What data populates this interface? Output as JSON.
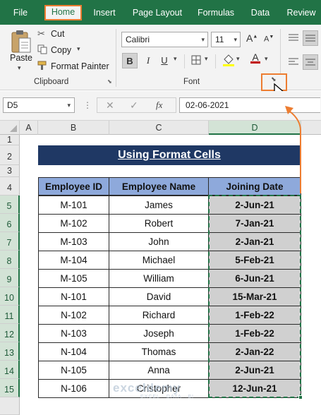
{
  "ribbon_tabs": [
    "File",
    "Home",
    "Insert",
    "Page Layout",
    "Formulas",
    "Data",
    "Review"
  ],
  "active_tab": "Home",
  "clipboard": {
    "paste": "Paste",
    "cut": "Cut",
    "copy": "Copy",
    "format_painter": "Format Painter",
    "group_label": "Clipboard"
  },
  "font": {
    "font_name": "Calibri",
    "font_size": "11",
    "bold": "B",
    "italic": "I",
    "underline": "U",
    "group_label": "Font",
    "grow_font": "A",
    "shrink_font": "A"
  },
  "formula_bar": {
    "name_box": "D5",
    "fx": "fx",
    "value": "02-06-2021"
  },
  "columns": [
    "A",
    "B",
    "C",
    "D"
  ],
  "rows": [
    "1",
    "2",
    "3",
    "4",
    "5",
    "6",
    "7",
    "8",
    "9",
    "10",
    "11",
    "12",
    "13",
    "14",
    "15"
  ],
  "sheet": {
    "title": "Using Format Cells",
    "headers": [
      "Employee ID",
      "Employee Name",
      "Joining Date"
    ],
    "rows": [
      {
        "id": "M-101",
        "name": "James",
        "date": "2-Jun-21"
      },
      {
        "id": "M-102",
        "name": "Robert",
        "date": "7-Jan-21"
      },
      {
        "id": "M-103",
        "name": "John",
        "date": "2-Jan-21"
      },
      {
        "id": "M-104",
        "name": "Michael",
        "date": "5-Feb-21"
      },
      {
        "id": "M-105",
        "name": "William",
        "date": "6-Jun-21"
      },
      {
        "id": "N-101",
        "name": "David",
        "date": "15-Mar-21"
      },
      {
        "id": "N-102",
        "name": "Richard",
        "date": "1-Feb-22"
      },
      {
        "id": "N-103",
        "name": "Joseph",
        "date": "1-Feb-22"
      },
      {
        "id": "N-104",
        "name": "Thomas",
        "date": "2-Jan-22"
      },
      {
        "id": "N-105",
        "name": "Anna",
        "date": "2-Jun-21"
      },
      {
        "id": "N-106",
        "name": "Cristopher",
        "date": "12-Jun-21"
      }
    ]
  },
  "watermark": {
    "brand": "exceldemy",
    "tagline": "EXCEL · DATA · BI"
  },
  "colors": {
    "excel_green": "#217346",
    "highlight_orange": "#ed7d31",
    "title_navy": "#1f3864",
    "header_blue": "#8ea9db",
    "date_gray": "#d0d0d0"
  }
}
